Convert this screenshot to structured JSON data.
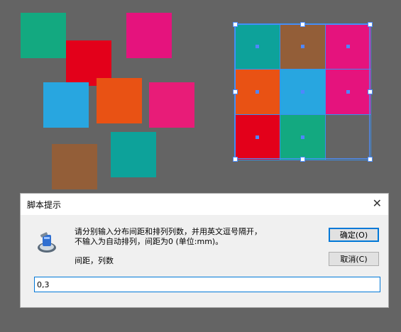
{
  "colors": {
    "teal": "#13A980",
    "magenta": "#E5137D",
    "red": "#E3001A",
    "blue": "#28A6E0",
    "orange": "#E95214",
    "pink": "#E81C78",
    "teal2": "#0DA29A",
    "brown": "#935E38",
    "selection": "#4B8DFF"
  },
  "loose_squares": [
    "teal",
    "magenta",
    "red",
    "blue",
    "orange",
    "pink",
    "teal2",
    "brown"
  ],
  "grid_cells": [
    "teal2",
    "brown",
    "magenta",
    "orange",
    "blue",
    "magenta",
    "red",
    "teal",
    "empty"
  ],
  "dialog": {
    "title": "脚本提示",
    "close_icon": "close-icon",
    "message_line1": "请分别输入分布间距和排列列数，并用英文逗号隔开，",
    "message_line2": "不输入为自动排列，间距为0 (单位:mm)。",
    "field_label": "间距，列数",
    "ok_label": "确定(O)",
    "cancel_label": "取消(C)",
    "input_value": "0,3"
  }
}
